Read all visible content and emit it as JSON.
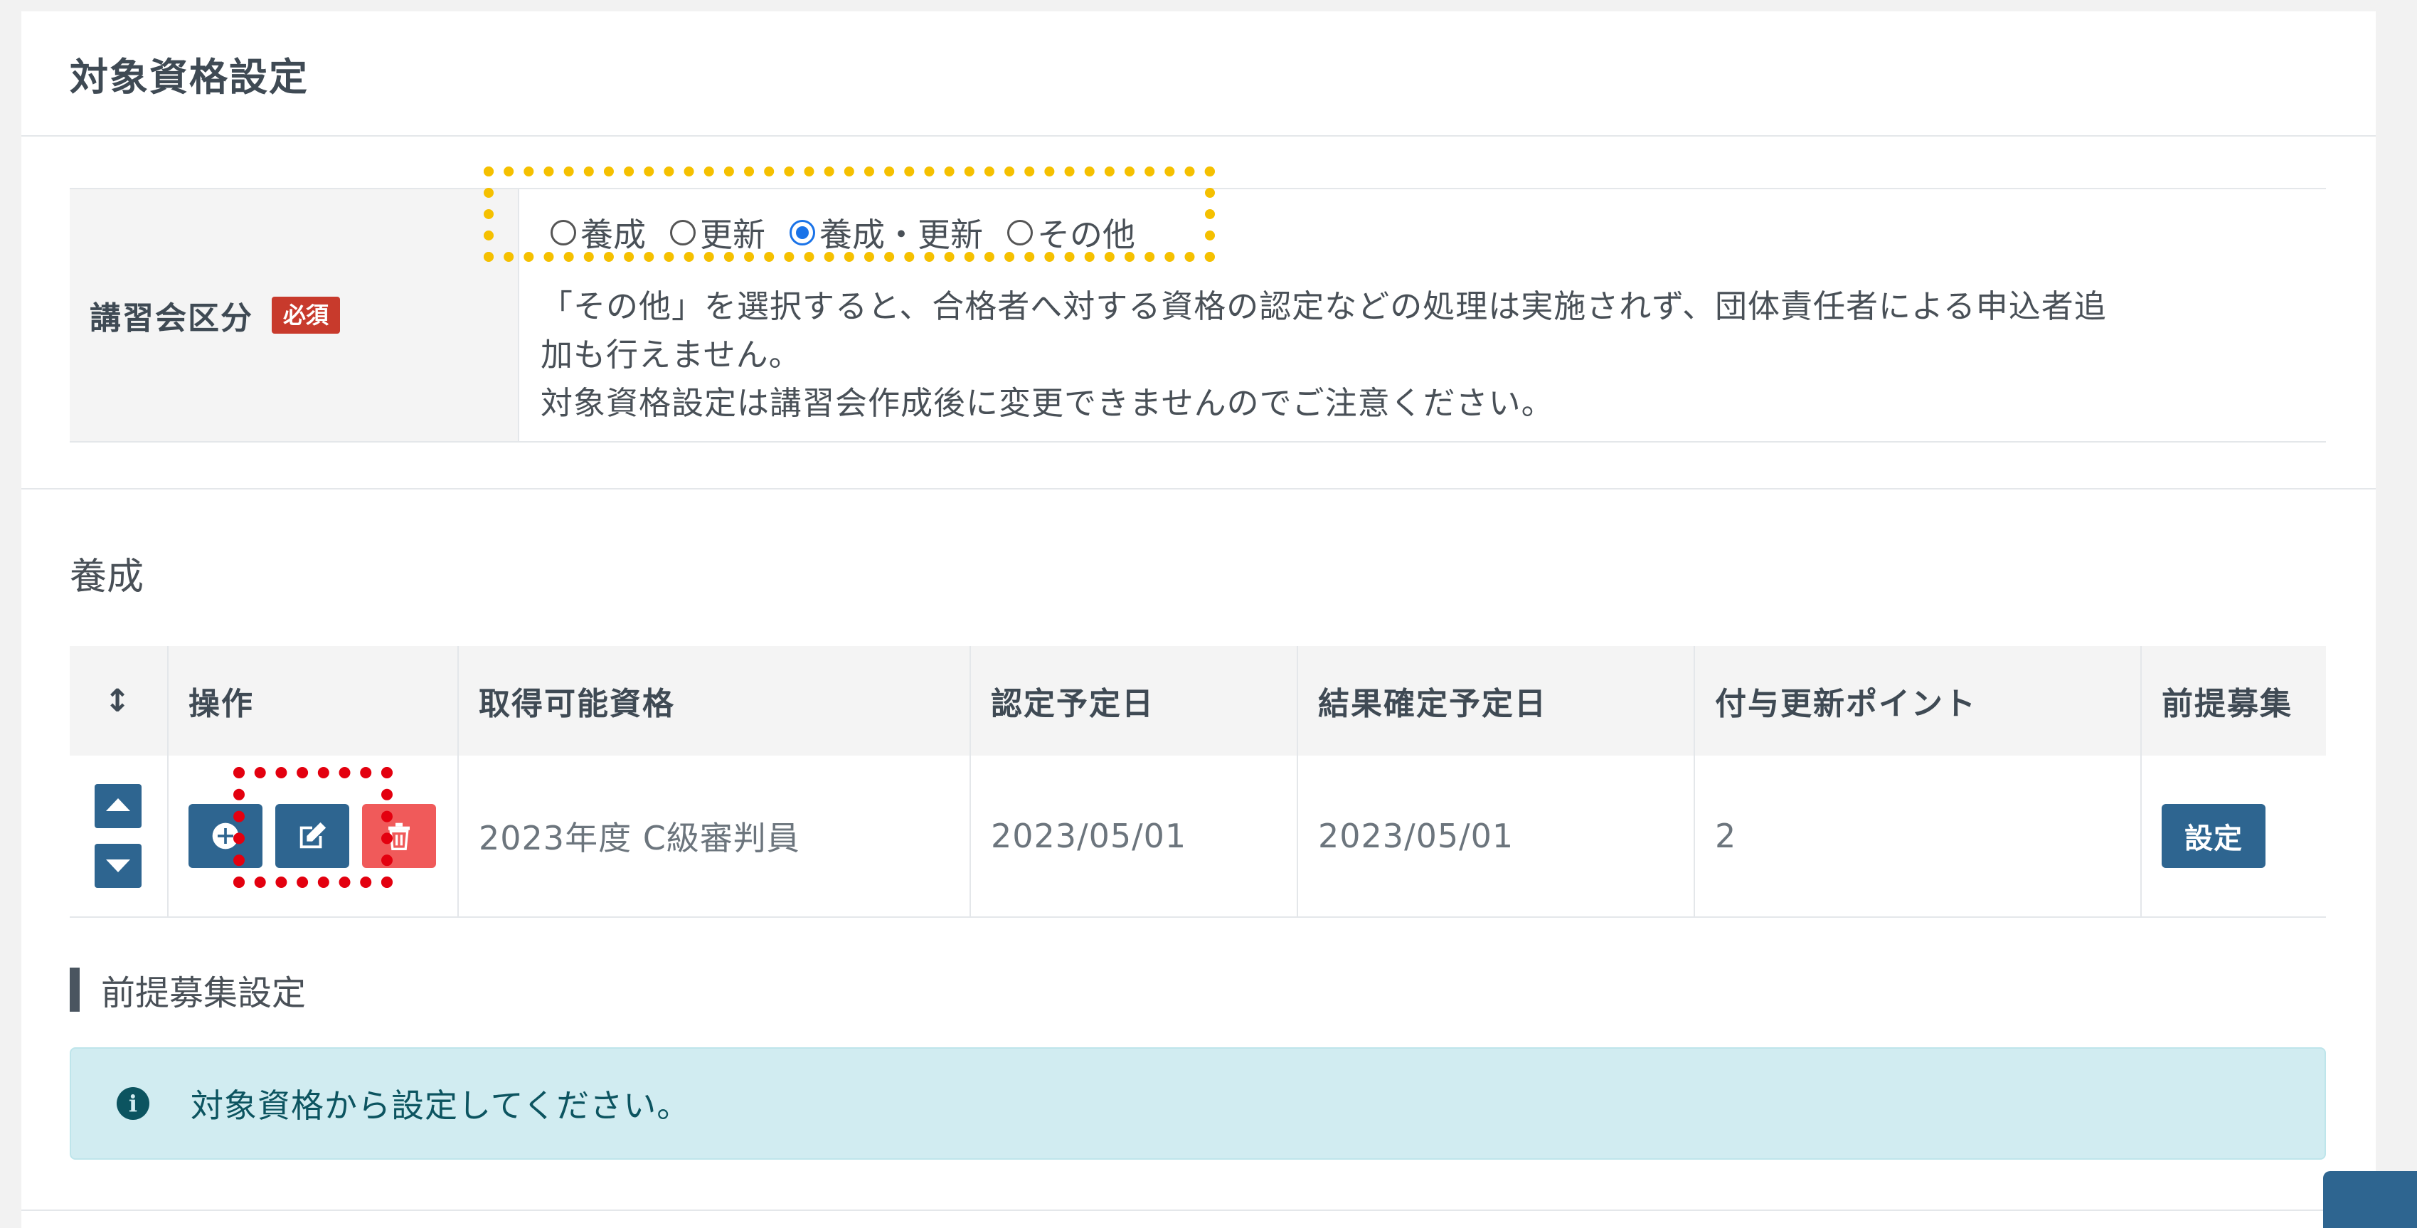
{
  "card": {
    "title": "対象資格設定"
  },
  "form": {
    "field_label": "講習会区分",
    "required_badge": "必須",
    "radio_options": [
      {
        "label": "養成",
        "checked": false
      },
      {
        "label": "更新",
        "checked": false
      },
      {
        "label": "養成・更新",
        "checked": true
      },
      {
        "label": "その他",
        "checked": false
      }
    ],
    "note_line1": "「その他」を選択すると、合格者へ対する資格の認定などの処理は実施されず、団体責任者による申込者追",
    "note_line1b": "加も行えません。",
    "note_line2": "対象資格設定は講習会作成後に変更できませんのでご注意ください。"
  },
  "section": {
    "title": "養成"
  },
  "table": {
    "headers": {
      "sort": "↕",
      "ops": "操作",
      "qualification": "取得可能資格",
      "cert_date": "認定予定日",
      "result_date": "結果確定予定日",
      "points": "付与更新ポイント",
      "prereq": "前提募集"
    },
    "rows": [
      {
        "qualification": "2023年度 C級審判員",
        "cert_date": "2023/05/01",
        "result_date": "2023/05/01",
        "points": "2",
        "prereq_button": "設定"
      }
    ]
  },
  "subsection": {
    "title": "前提募集設定"
  },
  "alert": {
    "icon": "info-icon",
    "text": "対象資格から設定してください。"
  },
  "colors": {
    "primary": "#2e6590",
    "danger": "#f05a5a",
    "required": "#c83a2c",
    "highlight_yellow": "#f5c000",
    "highlight_red": "#e3000f",
    "alert_bg": "#d1ecf1"
  }
}
